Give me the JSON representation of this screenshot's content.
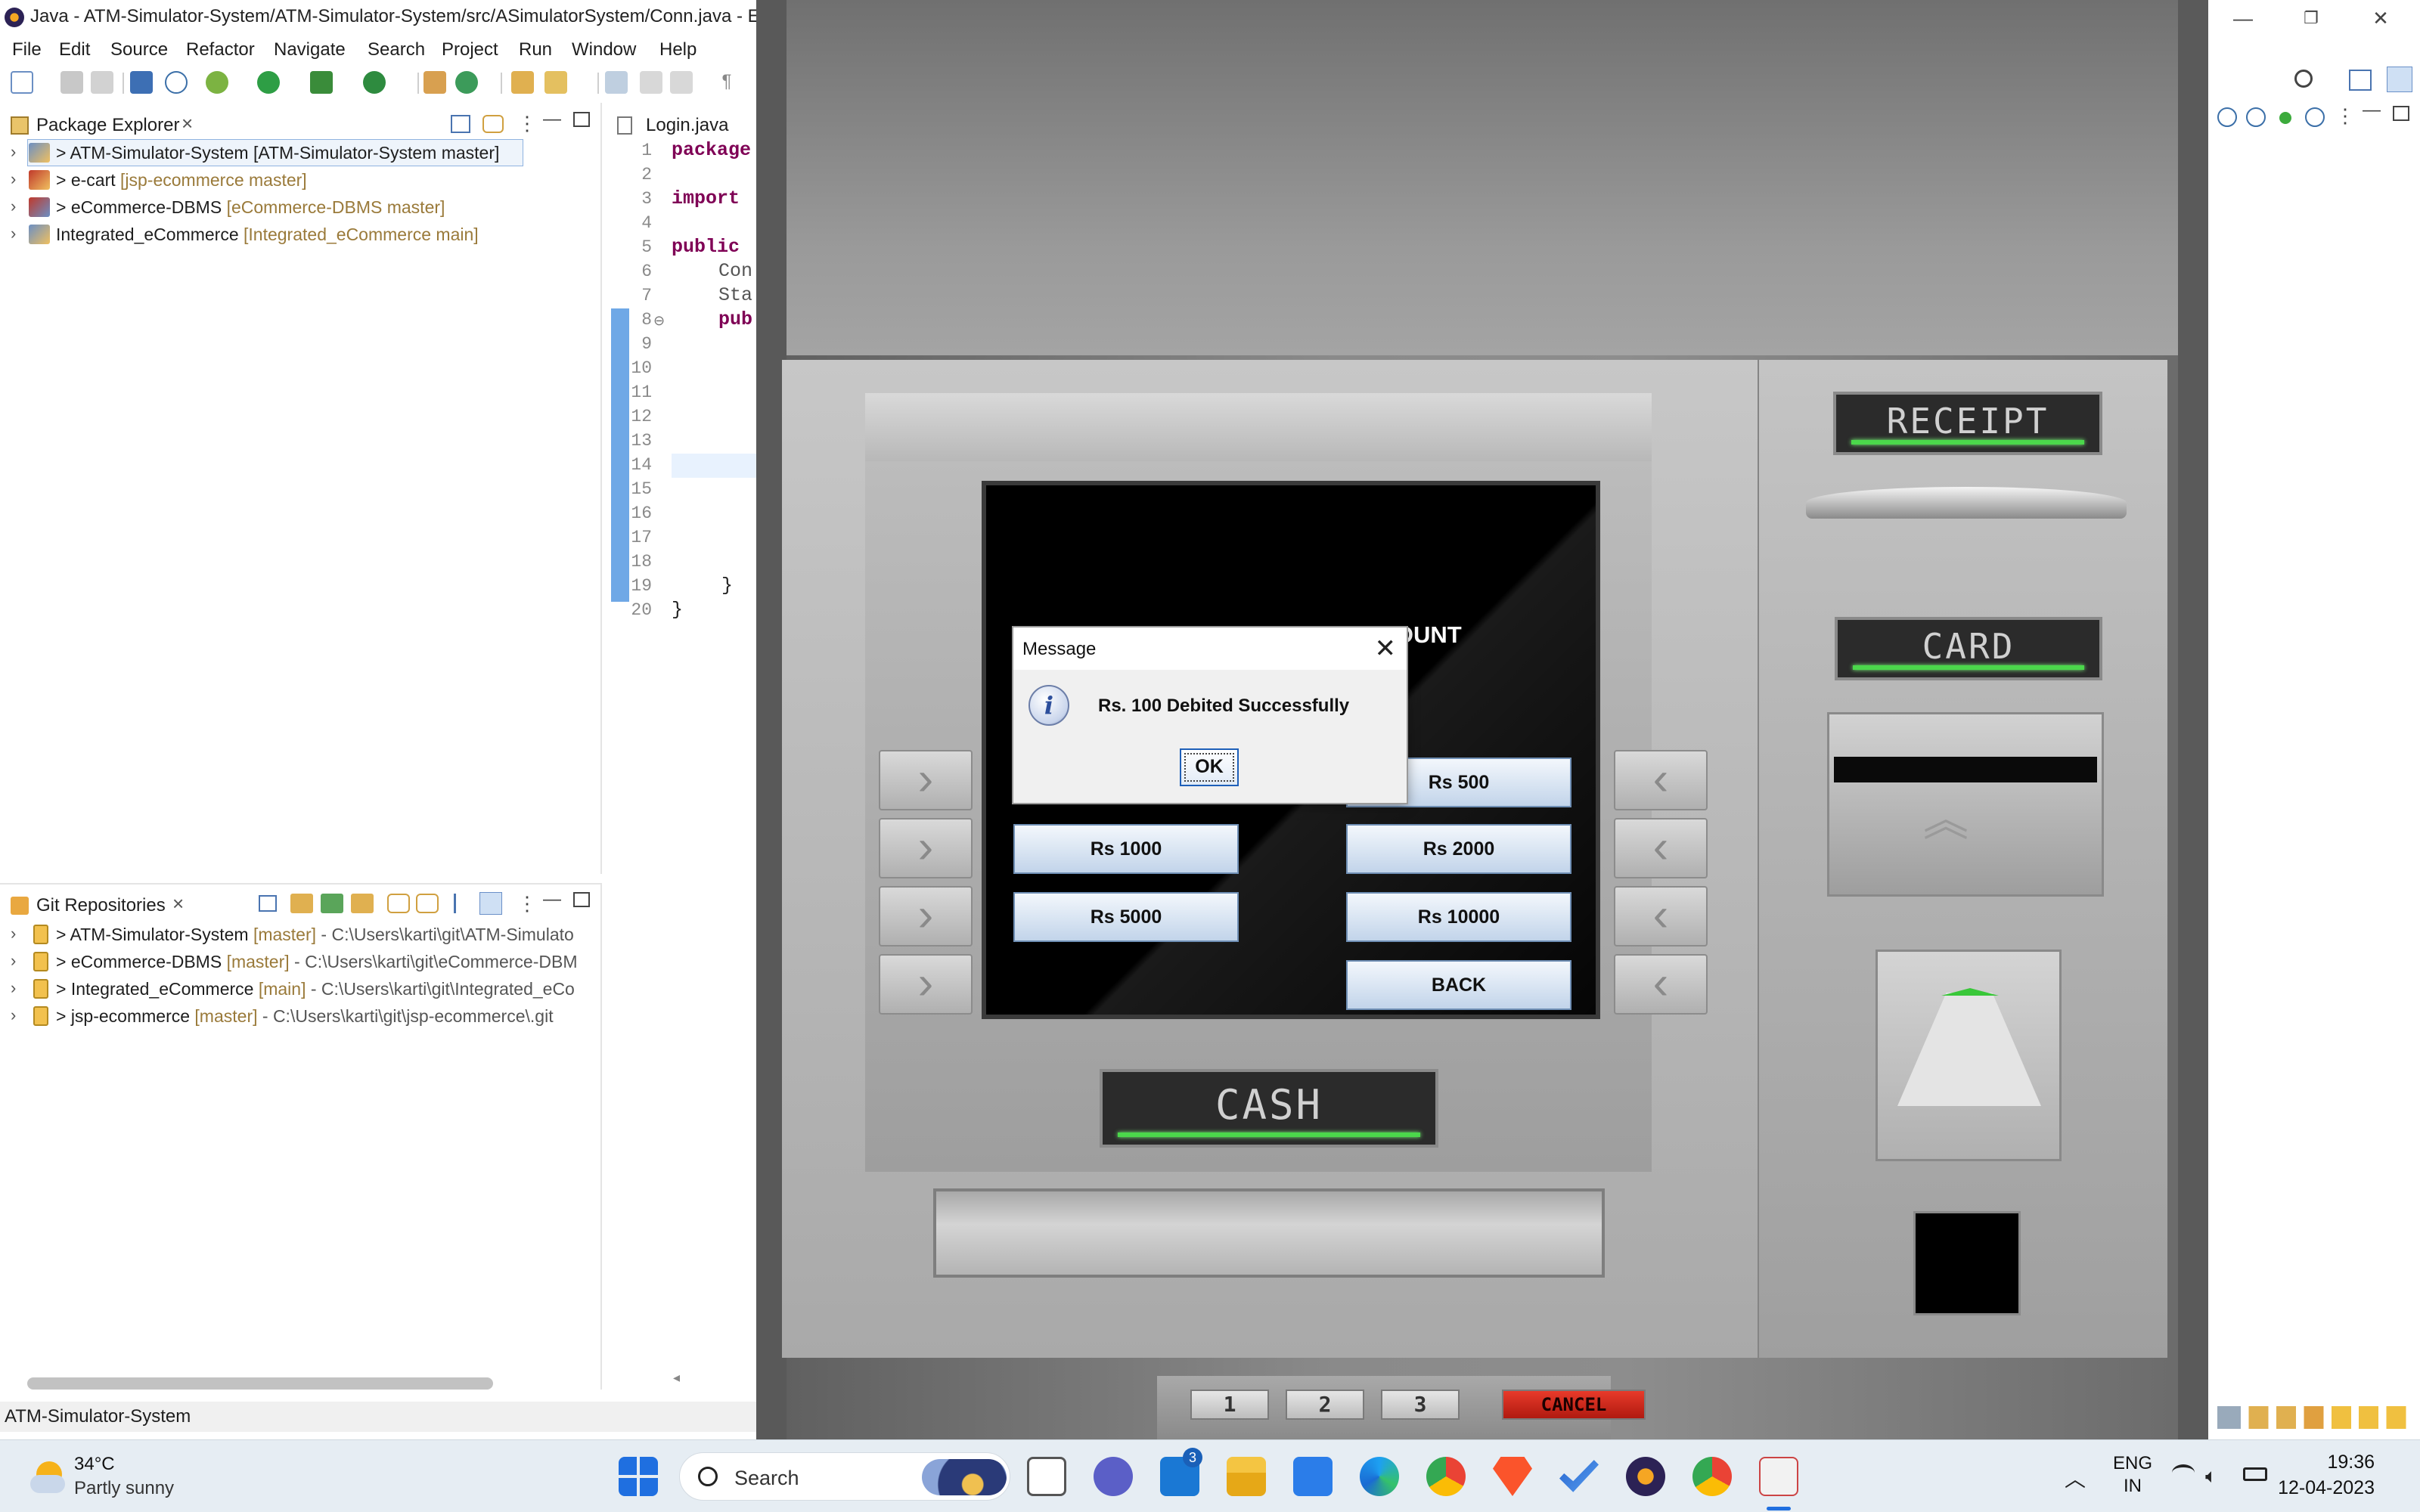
{
  "eclipse": {
    "title": "Java - ATM-Simulator-System/ATM-Simulator-System/src/ASimulatorSystem/Conn.java - Ec",
    "menu": [
      "File",
      "Edit",
      "Source",
      "Refactor",
      "Navigate",
      "Search",
      "Project",
      "Run",
      "Window",
      "Help"
    ],
    "package_explorer": {
      "tab_label": "Package Explorer",
      "items": [
        {
          "name": "> ATM-Simulator-System",
          "decoration": "[ATM-Simulator-System master]"
        },
        {
          "name": "> e-cart",
          "decoration": "[jsp-ecommerce master]"
        },
        {
          "name": "> eCommerce-DBMS",
          "decoration": "[eCommerce-DBMS master]"
        },
        {
          "name": "Integrated_eCommerce",
          "decoration": "[Integrated_eCommerce main]"
        }
      ]
    },
    "git_repositories": {
      "tab_label": "Git Repositories",
      "items": [
        {
          "name": "> ATM-Simulator-System",
          "branch": "[master]",
          "path": "- C:\\Users\\karti\\git\\ATM-Simulato"
        },
        {
          "name": "> eCommerce-DBMS",
          "branch": "[master]",
          "path": "- C:\\Users\\karti\\git\\eCommerce-DBM"
        },
        {
          "name": "> Integrated_eCommerce",
          "branch": "[main]",
          "path": "- C:\\Users\\karti\\git\\Integrated_eCo"
        },
        {
          "name": "> jsp-ecommerce",
          "branch": "[master]",
          "path": "- C:\\Users\\karti\\git\\jsp-ecommerce\\.git"
        }
      ]
    },
    "editor": {
      "tab_label": "Login.java",
      "line_numbers": [
        "1",
        "2",
        "3",
        "4",
        "5",
        "6",
        "7",
        "8",
        "9",
        "10",
        "11",
        "12",
        "13",
        "14",
        "15",
        "16",
        "17",
        "18",
        "19",
        "20"
      ],
      "code": {
        "l1": "package",
        "l3": "import",
        "l5": "public",
        "l6": "Con",
        "l7": "Sta",
        "l8": "pub",
        "l19": "}",
        "l20": "}"
      }
    },
    "status_bar": "ATM-Simulator-System"
  },
  "atm": {
    "screen_title": "SELECT WITHDRAWL AMOUNT",
    "amount_buttons": {
      "rs500": "Rs 500",
      "rs1000": "Rs 1000",
      "rs2000": "Rs 2000",
      "rs5000": "Rs 5000",
      "rs10000": "Rs 10000",
      "back": "BACK"
    },
    "labels": {
      "receipt": "RECEIPT",
      "card": "CARD",
      "cash": "CASH",
      "cancel": "CANCEL"
    },
    "keypad": [
      "1",
      "2",
      "3"
    ],
    "side_arrow_left": "›",
    "side_arrow_right": "‹"
  },
  "dialog": {
    "title": "Message",
    "message": "Rs. 100 Debited Successfully",
    "ok_label": "OK",
    "close_glyph": "✕",
    "info_glyph": "i"
  },
  "taskbar": {
    "weather_temp": "34°C",
    "weather_desc": "Partly sunny",
    "search_placeholder": "Search",
    "mail_badge": "3",
    "lang_line1": "ENG",
    "lang_line2": "IN",
    "time": "19:36",
    "date": "12-04-2023"
  },
  "colors": {
    "keyword": "#7f0055",
    "git_decoration": "#9a7a3a",
    "label_glow": "#4bd84b",
    "windows_blue": "#1f6fe0"
  }
}
